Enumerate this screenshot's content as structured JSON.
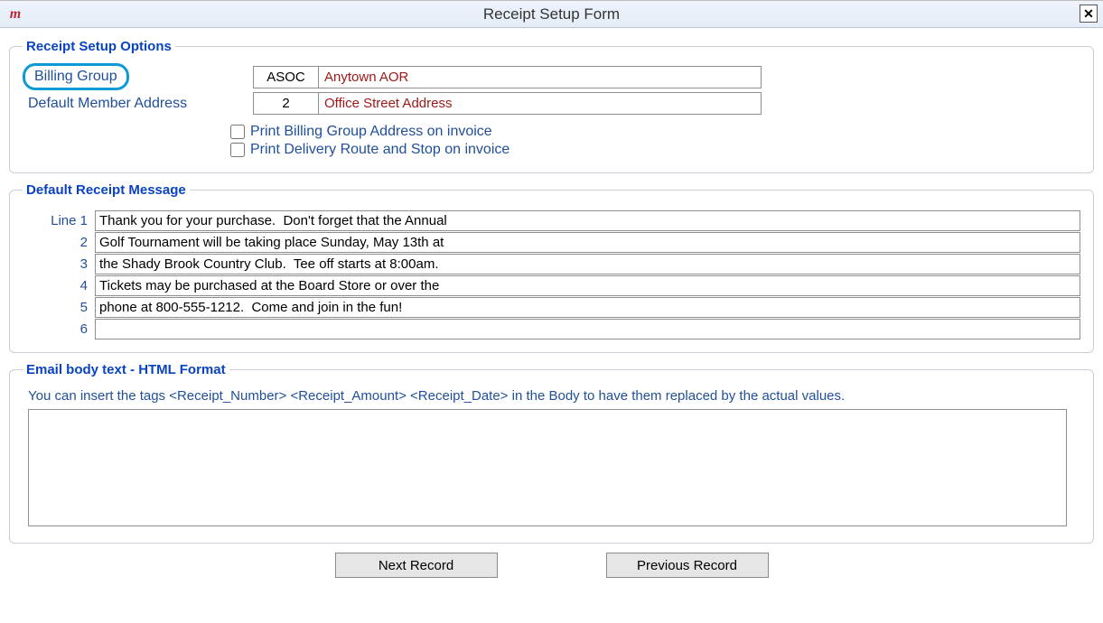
{
  "window": {
    "title": "Receipt Setup Form",
    "close_glyph": "✕"
  },
  "sections": {
    "options_title": "Receipt Setup Options",
    "message_title": "Default Receipt Message",
    "email_title": "Email body text - HTML Format"
  },
  "options": {
    "billing_group_label": "Billing Group",
    "billing_group_code": "ASOC",
    "billing_group_desc": "Anytown AOR",
    "default_member_label": "Default Member Address",
    "default_member_code": "2",
    "default_member_desc": "Office Street Address",
    "chk_print_billing_label": "Print Billing Group Address on invoice",
    "chk_print_billing_checked": false,
    "chk_print_delivery_label": "Print Delivery Route and Stop on invoice",
    "chk_print_delivery_checked": false
  },
  "message": {
    "line1_label": "Line 1",
    "labels": [
      "Line 1",
      "2",
      "3",
      "4",
      "5",
      "6"
    ],
    "lines": [
      "Thank you for your purchase.  Don't forget that the Annual",
      "Golf Tournament will be taking place Sunday, May 13th at",
      "the Shady Brook Country Club.  Tee off starts at 8:00am.",
      "Tickets may be purchased at the Board Store or over the",
      "phone at 800-555-1212.  Come and join in the fun!",
      ""
    ]
  },
  "email": {
    "hint": "You can insert the tags <Receipt_Number> <Receipt_Amount> <Receipt_Date> in the Body to have them replaced by the actual values.",
    "body": ""
  },
  "buttons": {
    "next": "Next Record",
    "previous": "Previous Record"
  }
}
